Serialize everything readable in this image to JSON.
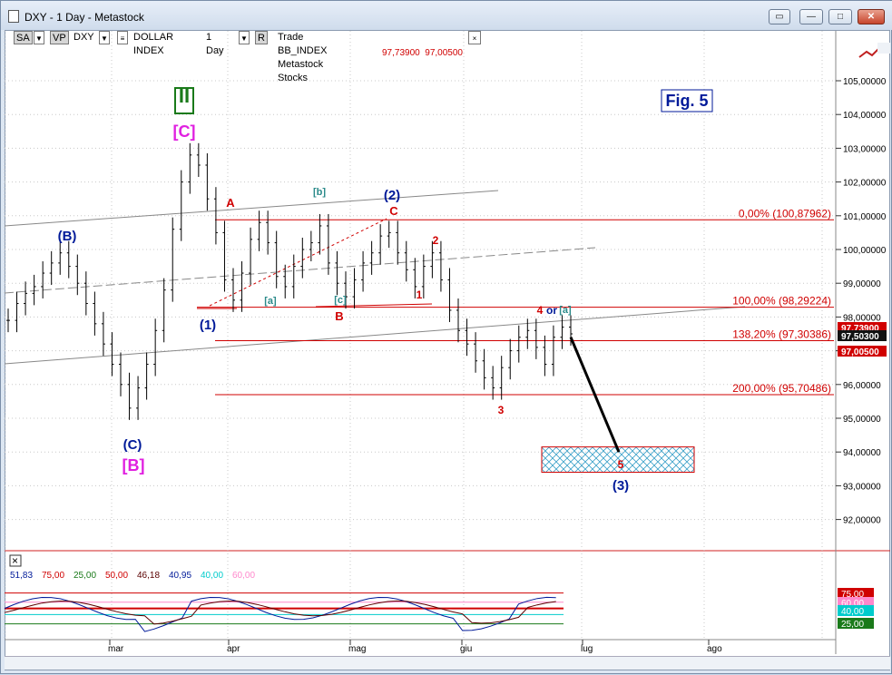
{
  "window": {
    "title": "DXY - 1 Day - Metastock",
    "buttons": [
      "restore-icon",
      "minimize-icon",
      "maximize-icon",
      "close-icon"
    ]
  },
  "toolbar": {
    "sa": "SA",
    "vp": "VP",
    "symbol": "DXY",
    "name": "DOLLAR INDEX",
    "period": "1 Day",
    "r": "R",
    "source": "Trade BB_INDEX Metastock Stocks",
    "close_glyph": "×"
  },
  "readout": {
    "price1": "97,73900",
    "price2": "97,00500"
  },
  "figure_label": "Fig. 5",
  "colors": {
    "bull": "#30b030",
    "bear": "#c020c0",
    "red": "#d00000",
    "navy": "#001a99",
    "magenta": "#e020e0",
    "teal": "#2a8a8a"
  },
  "chart_data": {
    "type": "line",
    "title": "",
    "ylim": [
      90.9,
      106
    ],
    "y_ticks": [
      "105,00000",
      "104,00000",
      "103,00000",
      "102,00000",
      "101,00000",
      "100,00000",
      "99,00000",
      "98,00000",
      "97,00000",
      "96,00000",
      "95,00000",
      "94,00000",
      "93,00000",
      "92,00000"
    ],
    "x_ticks": [
      "mar",
      "apr",
      "mag",
      "giu",
      "lug",
      "ago"
    ],
    "series": [
      {
        "values": [
          97.9,
          98.4,
          98.7,
          98.9,
          99.3,
          99.6,
          99.9,
          99.5,
          99.0,
          98.4,
          97.8,
          97.2,
          96.6,
          96.0,
          95.3,
          95.9,
          96.6,
          97.6,
          98.8,
          100.6,
          102.0,
          102.8,
          102.5,
          101.5,
          100.5,
          99.1,
          98.5,
          99.3,
          100.3,
          100.8,
          100.2,
          99.2,
          98.9,
          99.5,
          100.0,
          100.2,
          100.7,
          99.6,
          99.0,
          98.6,
          99.1,
          99.6,
          99.9,
          100.4,
          100.5,
          99.9,
          99.4,
          98.9,
          99.5,
          99.9,
          99.1,
          98.2,
          97.6,
          97.2,
          96.7,
          96.2,
          95.9,
          96.5,
          97.0,
          97.4,
          97.6,
          97.1,
          96.6,
          97.4,
          97.7,
          97.5
        ]
      }
    ],
    "fib_levels": [
      {
        "label": "0,00% (100,87962)",
        "value": 100.88
      },
      {
        "label": "100,00% (98,29224)",
        "value": 98.29
      },
      {
        "label": "138,20% (97,30386)",
        "value": 97.3
      },
      {
        "label": "200,00% (95,70486)",
        "value": 95.7
      }
    ],
    "price_tags": [
      {
        "label": "97,73900",
        "value": 97.739,
        "color": "#d00000"
      },
      {
        "label": "97,50300",
        "value": 97.503,
        "color": "#111111"
      },
      {
        "label": "97,00500",
        "value": 97.005,
        "color": "#d00000"
      }
    ],
    "wave_labels": [
      {
        "text": "II",
        "color": "#1a7a1a"
      },
      {
        "text": "[C]",
        "color": "#e020e0"
      },
      {
        "text": "(B)",
        "color": "#001a99"
      },
      {
        "text": "(C)",
        "color": "#001a99"
      },
      {
        "text": "[B]",
        "color": "#e020e0"
      },
      {
        "text": "(1)",
        "color": "#001a99"
      },
      {
        "text": "(2)",
        "color": "#001a99"
      },
      {
        "text": "(3)",
        "color": "#001a99"
      },
      {
        "text": "A",
        "color": "#d00000"
      },
      {
        "text": "B",
        "color": "#d00000"
      },
      {
        "text": "C",
        "color": "#d00000"
      },
      {
        "text": "[a]",
        "color": "#2a8a8a"
      },
      {
        "text": "[b]",
        "color": "#2a8a8a"
      },
      {
        "text": "[c]",
        "color": "#2a8a8a"
      },
      {
        "text": "1",
        "color": "#d00000"
      },
      {
        "text": "2",
        "color": "#d00000"
      },
      {
        "text": "3",
        "color": "#d00000"
      },
      {
        "text": "4",
        "color": "#d00000"
      },
      {
        "text": "or",
        "color": "#001a99"
      },
      {
        "text": "[a]",
        "color": "#2a8a8a"
      },
      {
        "text": "5",
        "color": "#d00000"
      }
    ]
  },
  "indicator": {
    "values": [
      {
        "text": "51,83",
        "color": "#001a99"
      },
      {
        "text": "75,00",
        "color": "#d00000"
      },
      {
        "text": "25,00",
        "color": "#1a7a1a"
      },
      {
        "text": "50,00",
        "color": "#d00000"
      },
      {
        "text": "46,18",
        "color": "#5a0000"
      },
      {
        "text": "40,95",
        "color": "#001a99"
      },
      {
        "text": "40,00",
        "color": "#00cccc"
      },
      {
        "text": "60,00",
        "color": "#ff88cc"
      }
    ],
    "axis_tags": [
      "75,00",
      "60,00",
      "40,00",
      "25,00"
    ]
  }
}
